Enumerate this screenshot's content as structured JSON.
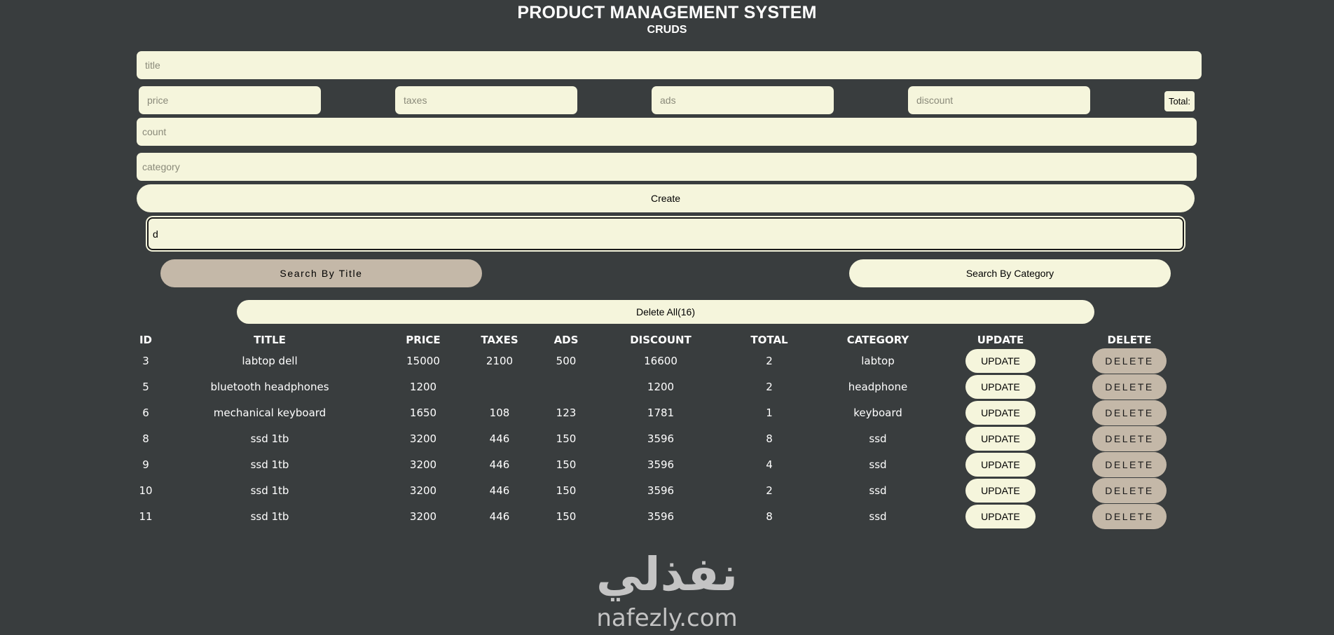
{
  "header": {
    "title": "PRODUCT MANAGEMENT SYSTEM",
    "subtitle": "CRUDS"
  },
  "form": {
    "title_placeholder": "title",
    "price_placeholder": "price",
    "taxes_placeholder": "taxes",
    "ads_placeholder": "ads",
    "discount_placeholder": "discount",
    "total_label": "Total:",
    "count_placeholder": "count",
    "category_placeholder": "category",
    "create_label": "Create"
  },
  "search": {
    "value": "d",
    "by_title_label": "Search By Title",
    "by_category_label": "Search By Category"
  },
  "delete_all_label": "Delete All(16)",
  "table": {
    "headers": [
      "ID",
      "TITLE",
      "PRICE",
      "TAXES",
      "ADS",
      "DISCOUNT",
      "TOTAL",
      "CATEGORY",
      "UPDATE",
      "DELETE"
    ],
    "update_label": "UPDATE",
    "delete_label": "DELETE",
    "rows": [
      {
        "id": "3",
        "title": "labtop dell",
        "price": "15000",
        "taxes": "2100",
        "ads": "500",
        "discount": "16600",
        "total": "2",
        "category": "labtop"
      },
      {
        "id": "5",
        "title": "bluetooth headphones",
        "price": "1200",
        "taxes": "",
        "ads": "",
        "discount": "1200",
        "total": "2",
        "category": "headphone"
      },
      {
        "id": "6",
        "title": "mechanical keyboard",
        "price": "1650",
        "taxes": "108",
        "ads": "123",
        "discount": "1781",
        "total": "1",
        "category": "keyboard"
      },
      {
        "id": "8",
        "title": "ssd 1tb",
        "price": "3200",
        "taxes": "446",
        "ads": "150",
        "discount": "3596",
        "total": "8",
        "category": "ssd"
      },
      {
        "id": "9",
        "title": "ssd 1tb",
        "price": "3200",
        "taxes": "446",
        "ads": "150",
        "discount": "3596",
        "total": "4",
        "category": "ssd"
      },
      {
        "id": "10",
        "title": "ssd 1tb",
        "price": "3200",
        "taxes": "446",
        "ads": "150",
        "discount": "3596",
        "total": "2",
        "category": "ssd"
      },
      {
        "id": "11",
        "title": "ssd 1tb",
        "price": "3200",
        "taxes": "446",
        "ads": "150",
        "discount": "3596",
        "total": "8",
        "category": "ssd"
      }
    ]
  },
  "watermark": {
    "arabic": "نفذلي",
    "latin": "nafezly.com"
  }
}
